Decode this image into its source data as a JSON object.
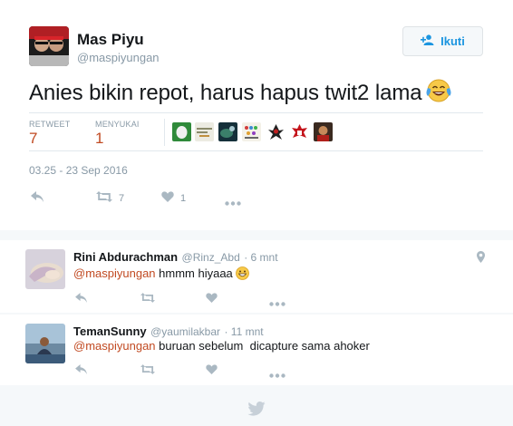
{
  "tweet": {
    "display_name": "Mas Piyu",
    "handle": "@maspiyungan",
    "text": "Anies bikin repot, harus hapus twit2 lama",
    "text_emoji": "tears-of-joy-emoji",
    "follow_label": "Ikuti",
    "retweet_label": "RETWEET",
    "retweet_count": "7",
    "likes_label": "MENYUKAI",
    "likes_count": "1",
    "timestamp": "03.25 - 23 Sep 2016",
    "action_retweet_count": "7",
    "action_like_count": "1"
  },
  "replies": [
    {
      "display_name": "Rini Abdurachman",
      "handle": "@Rinz_Abd",
      "time": "· 6 mnt",
      "mention": "@maspiyungan",
      "text": " hmmm hiyaaa",
      "emoji": "grinning-emoji",
      "has_location": true
    },
    {
      "display_name": "TemanSunny",
      "handle": "@yaumilakbar",
      "time": "· 11 mnt",
      "mention": "@maspiyungan",
      "text": " buruan sebelum  dicapture sama ahoker"
    }
  ],
  "icons": {
    "reply": "reply-icon",
    "retweet": "retweet-icon",
    "like": "heart-icon",
    "more": "more-dots-icon",
    "follow": "add-user-icon",
    "footer": "twitter-bird-icon",
    "location": "location-pin-icon"
  },
  "colors": {
    "accent": "#1b95e0",
    "stat_value": "#c14a22",
    "mention": "#c14a22",
    "muted": "#8899a6",
    "icon": "#aab8c2"
  }
}
